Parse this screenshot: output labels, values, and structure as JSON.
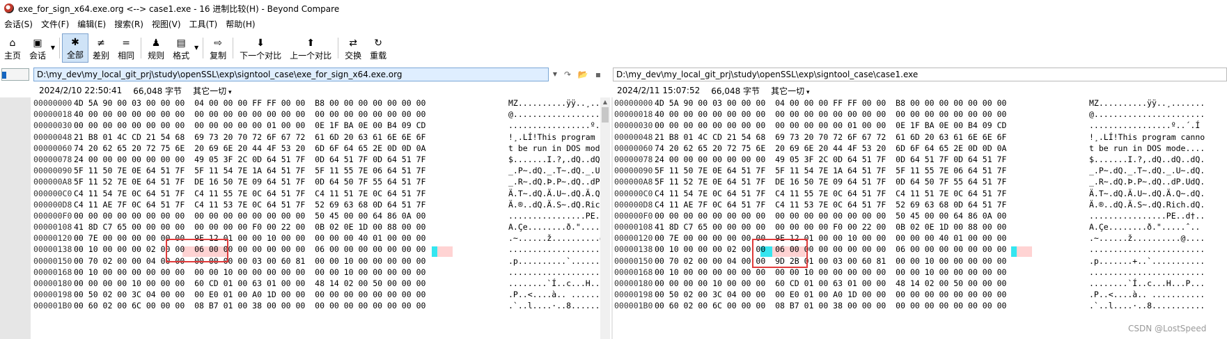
{
  "window": {
    "title": "exe_for_sign_x64.exe.org <--> case1.exe - 16 进制比较(H) - Beyond Compare"
  },
  "menu": [
    "会话(S)",
    "文件(F)",
    "编辑(E)",
    "搜索(R)",
    "视图(V)",
    "工具(T)",
    "帮助(H)"
  ],
  "toolbar": [
    {
      "label": "主页",
      "icon": "home-icon",
      "glyph": "⌂"
    },
    {
      "label": "会话",
      "icon": "briefcase-icon",
      "glyph": "▣",
      "dropdown": true
    },
    {
      "label": "全部",
      "icon": "asterisk-icon",
      "glyph": "✱",
      "active": true
    },
    {
      "label": "差别",
      "icon": "not-equal-icon",
      "glyph": "≠"
    },
    {
      "label": "相同",
      "icon": "equal-icon",
      "glyph": "="
    },
    {
      "label": "规则",
      "icon": "referee-icon",
      "glyph": "♟"
    },
    {
      "label": "格式",
      "icon": "format-icon",
      "glyph": "▤",
      "dropdown": true
    },
    {
      "label": "复制",
      "icon": "copy-arrow-icon",
      "glyph": "⇨"
    },
    {
      "label": "下一个对比",
      "icon": "down-arrow-icon",
      "glyph": "⬇"
    },
    {
      "label": "上一个对比",
      "icon": "up-arrow-icon",
      "glyph": "⬆"
    },
    {
      "label": "交换",
      "icon": "swap-icon",
      "glyph": "⇄"
    },
    {
      "label": "重载",
      "icon": "reload-icon",
      "glyph": "↻"
    }
  ],
  "left": {
    "path": "D:\\my_dev\\my_local_git_prj\\study\\openSSL\\exp\\signtool_case\\exe_for_sign_x64.exe.org",
    "date": "2024/2/10 22:50:41",
    "size": "66,048 字节",
    "filter": "其它一切",
    "rows": [
      [
        "00000000",
        "4D 5A 90 00 03 00 00 00  04 00 00 00 FF FF 00 00  B8 00 00 00 00 00 00 00",
        "MZ..........ÿÿ..¸......."
      ],
      [
        "00000018",
        "40 00 00 00 00 00 00 00  00 00 00 00 00 00 00 00  00 00 00 00 00 00 00 00",
        "@......................."
      ],
      [
        "00000030",
        "00 00 00 00 00 00 00 00  00 00 00 00 00 01 00 00  0E 1F BA 0E 00 B4 09 CD",
        ".................º..´.Í"
      ],
      [
        "00000048",
        "21 B8 01 4C CD 21 54 68  69 73 20 70 72 6F 67 72  61 6D 20 63 61 6E 6E 6F",
        "!¸.LÍ!This program canno"
      ],
      [
        "00000060",
        "74 20 62 65 20 72 75 6E  20 69 6E 20 44 4F 53 20  6D 6F 64 65 2E 0D 0D 0A",
        "t be run in DOS mode...."
      ],
      [
        "00000078",
        "24 00 00 00 00 00 00 00  49 05 3F 2C 0D 64 51 7F  0D 64 51 7F 0D 64 51 7F",
        "$.......I.?,.dQ..dQ..dQ."
      ],
      [
        "00000090",
        "5F 11 50 7E 0E 64 51 7F  5F 11 54 7E 1A 64 51 7F  5F 11 55 7E 06 64 51 7F",
        "_.P~.dQ._.T~.dQ._.U~.dQ."
      ],
      [
        "000000A8",
        "5F 11 52 7E 0E 64 51 7F  DE 16 50 7E 09 64 51 7F  0D 64 50 7F 55 64 51 7F",
        "_.R~.dQ.Þ.P~.dQ..dP.UdQ."
      ],
      [
        "000000C0",
        "C4 11 54 7E 0C 64 51 7F  C4 11 55 7E 0C 64 51 7F  C4 11 51 7E 0C 64 51 7F",
        "Ä.T~.dQ.Ä.U~.dQ.Ä.Q~.dQ."
      ],
      [
        "000000D8",
        "C4 11 AE 7F 0C 64 51 7F  C4 11 53 7E 0C 64 51 7F  52 69 63 68 0D 64 51 7F",
        "Ä.®..dQ.Ä.S~.dQ.Rich.dQ."
      ],
      [
        "000000F0",
        "00 00 00 00 00 00 00 00  00 00 00 00 00 00 00 00  50 45 00 00 64 86 0A 00",
        "................PE..d†.."
      ],
      [
        "00000108",
        "41 8D C7 65 00 00 00 00  00 00 00 00 F0 00 22 00  0B 02 0E 1D 00 88 00 00",
        "A.Çe........ð.\".....ˆ.."
      ],
      [
        "00000120",
        "00 7E 00 00 00 00 00 00  9E 12 01 00 00 10 00 00  00 00 00 40 01 00 00 00",
        ".~......ž..........@...."
      ],
      [
        "00000138",
        "00 10 00 00 00 02 00 00  06 00 00 00 00 00 00 00  06 00 00 00 00 00 00 00",
        "........................"
      ],
      [
        "00000150",
        "00 70 02 00 00 04 00 00  00 00 00 00 03 00 60 81  00 00 10 00 00 00 00 00",
        ".p..........`..........."
      ],
      [
        "00000168",
        "00 10 00 00 00 00 00 00  00 00 10 00 00 00 00 00  00 00 10 00 00 00 00 00",
        "........................"
      ],
      [
        "00000180",
        "00 00 00 00 10 00 00 00  60 CD 01 00 63 01 00 00  48 14 02 00 50 00 00 00",
        "........`Í..c...H...P..."
      ],
      [
        "00000198",
        "00 50 02 00 3C 04 00 00  00 E0 01 00 A0 1D 00 00  00 00 00 00 00 00 00 00",
        ".P..<....à.. ..........."
      ],
      [
        "000001B0",
        "00 60 02 00 6C 00 00 00  08 B7 01 00 38 00 00 00  00 00 00 00 00 00 00 00",
        ".`..l....·..8..........."
      ]
    ]
  },
  "right": {
    "path": "D:\\my_dev\\my_local_git_prj\\study\\openSSL\\exp\\signtool_case\\case1.exe",
    "date": "2024/2/11 15:07:52",
    "size": "66,048 字节",
    "filter": "其它一切",
    "rows": [
      [
        "00000000",
        "4D 5A 90 00 03 00 00 00  04 00 00 00 FF FF 00 00  B8 00 00 00 00 00 00 00",
        "MZ..........ÿÿ..¸......."
      ],
      [
        "00000018",
        "40 00 00 00 00 00 00 00  00 00 00 00 00 00 00 00  00 00 00 00 00 00 00 00",
        "@......................."
      ],
      [
        "00000030",
        "00 00 00 00 00 00 00 00  00 00 00 00 00 01 00 00  0E 1F BA 0E 00 B4 09 CD",
        ".................º..´.Í"
      ],
      [
        "00000048",
        "21 B8 01 4C CD 21 54 68  69 73 20 70 72 6F 67 72  61 6D 20 63 61 6E 6E 6F",
        "!¸.LÍ!This program canno"
      ],
      [
        "00000060",
        "74 20 62 65 20 72 75 6E  20 69 6E 20 44 4F 53 20  6D 6F 64 65 2E 0D 0D 0A",
        "t be run in DOS mode...."
      ],
      [
        "00000078",
        "24 00 00 00 00 00 00 00  49 05 3F 2C 0D 64 51 7F  0D 64 51 7F 0D 64 51 7F",
        "$.......I.?,.dQ..dQ..dQ."
      ],
      [
        "00000090",
        "5F 11 50 7E 0E 64 51 7F  5F 11 54 7E 1A 64 51 7F  5F 11 55 7E 06 64 51 7F",
        "_.P~.dQ._.T~.dQ._.U~.dQ."
      ],
      [
        "000000A8",
        "5F 11 52 7E 0E 64 51 7F  DE 16 50 7E 09 64 51 7F  0D 64 50 7F 55 64 51 7F",
        "_.R~.dQ.Þ.P~.dQ..dP.UdQ."
      ],
      [
        "000000C0",
        "C4 11 54 7E 0C 64 51 7F  C4 11 55 7E 0C 64 51 7F  C4 11 51 7E 0C 64 51 7F",
        "Ä.T~.dQ.Ä.U~.dQ.Ä.Q~.dQ."
      ],
      [
        "000000D8",
        "C4 11 AE 7F 0C 64 51 7F  C4 11 53 7E 0C 64 51 7F  52 69 63 68 0D 64 51 7F",
        "Ä.®..dQ.Ä.S~.dQ.Rich.dQ."
      ],
      [
        "000000F0",
        "00 00 00 00 00 00 00 00  00 00 00 00 00 00 00 00  50 45 00 00 64 86 0A 00",
        "................PE..d†.."
      ],
      [
        "00000108",
        "41 8D C7 65 00 00 00 00  00 00 00 00 F0 00 22 00  0B 02 0E 1D 00 88 00 00",
        "A.Çe........ð.\".....ˆ.."
      ],
      [
        "00000120",
        "00 7E 00 00 00 00 00 00  9E 12 01 00 00 10 00 00  00 00 00 40 01 00 00 00",
        ".~......ž..........@...."
      ],
      [
        "00000138",
        "00 10 00 00 00 02 00 00  06 00 00 00 00 00 00 00  06 00 00 00 00 00 00 00",
        "........................"
      ],
      [
        "00000150",
        "00 70 02 00 00 04 00 00  9D 2B 01 00 03 00 60 81  00 00 10 00 00 00 00 00",
        ".p.......+..`..........."
      ],
      [
        "00000168",
        "00 10 00 00 00 00 00 00  00 00 10 00 00 00 00 00  00 00 10 00 00 00 00 00",
        "........................"
      ],
      [
        "00000180",
        "00 00 00 00 10 00 00 00  60 CD 01 00 63 01 00 00  48 14 02 00 50 00 00 00",
        "........`Í..c...H...P..."
      ],
      [
        "00000198",
        "00 50 02 00 3C 04 00 00  00 E0 01 00 A0 1D 00 00  00 00 00 00 00 00 00 00",
        ".P..<....à.. ..........."
      ],
      [
        "000001B0",
        "00 60 02 00 6C 00 00 00  08 B7 01 00 38 00 00 00  00 00 00 00 00 00 00 00",
        ".`..l....·..8..........."
      ]
    ]
  },
  "watermark": "CSDN @LostSpeed",
  "colors": {
    "diff_box": "#e03b3b",
    "diff_fill": "#ffd3d3",
    "cursor": "#35e6f0",
    "active_button": "#cfe3f7",
    "left_path_bg": "#dfeeff"
  }
}
